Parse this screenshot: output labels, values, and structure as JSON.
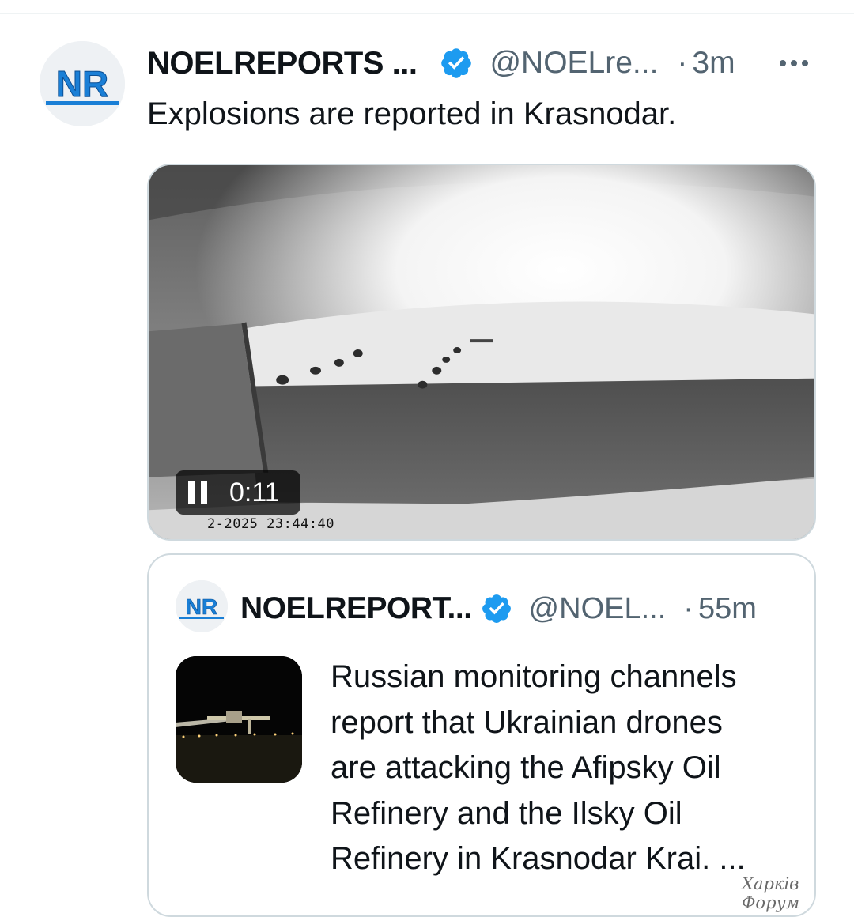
{
  "post": {
    "author_name": "NOELREPORTS ...",
    "handle": "@NOELre...",
    "separator": "·",
    "time": "3m",
    "text": "Explosions are reported in Krasnodar.",
    "avatar_label": "NR",
    "more_icon": "more-horizontal-icon",
    "verified_icon": "verified-badge-icon"
  },
  "video": {
    "state": "playing",
    "duration": "0:11",
    "timestamp_overlay": "2-2025 23:44:40",
    "pause_icon": "pause-icon"
  },
  "quote": {
    "author_name": "NOELREPORT...",
    "handle": "@NOEL...",
    "separator": "·",
    "time": "55m",
    "avatar_label": "NR",
    "text_lines": [
      "Russian monitoring channels",
      "report that Ukrainian drones",
      "are attacking the Afipsky Oil",
      "Refinery and the Ilsky Oil",
      "Refinery in Krasnodar Krai. ..."
    ]
  },
  "watermark": "Харків Форум",
  "colors": {
    "brand_blue": "#1d9bf0",
    "logo_blue": "#1a7fd6",
    "muted_text": "#536471",
    "border": "#cfd9de"
  }
}
